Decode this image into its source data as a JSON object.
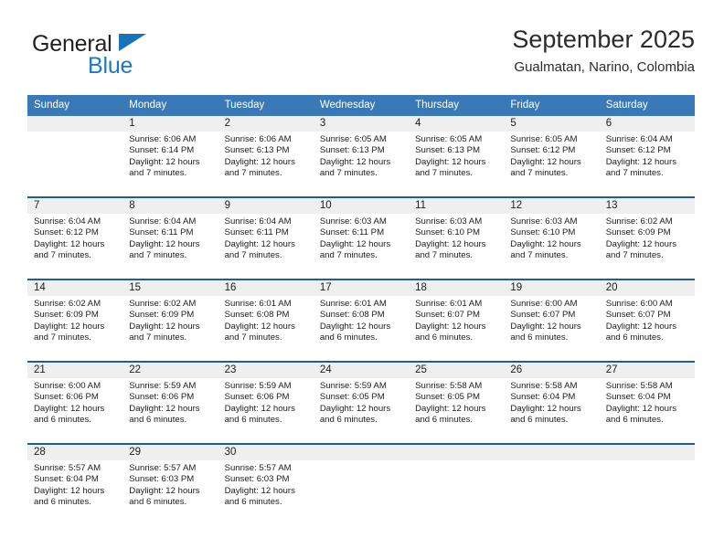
{
  "logo": {
    "word1": "General",
    "word2": "Blue",
    "triangle_color": "#1573ba",
    "word2_color": "#1b7ac0"
  },
  "header": {
    "title": "September 2025",
    "subtitle": "Gualmatan, Narino, Colombia"
  },
  "theme": {
    "header_blue": "#3a79b8",
    "row_divider_blue": "#1a5e9e",
    "day_band_gray": "#efefef"
  },
  "weekdays": [
    "Sunday",
    "Monday",
    "Tuesday",
    "Wednesday",
    "Thursday",
    "Friday",
    "Saturday"
  ],
  "weeks": [
    [
      {
        "day": "",
        "empty": true
      },
      {
        "day": "1",
        "sunrise": "Sunrise: 6:06 AM",
        "sunset": "Sunset: 6:14 PM",
        "daylight_l1": "Daylight: 12 hours",
        "daylight_l2": "and 7 minutes."
      },
      {
        "day": "2",
        "sunrise": "Sunrise: 6:06 AM",
        "sunset": "Sunset: 6:13 PM",
        "daylight_l1": "Daylight: 12 hours",
        "daylight_l2": "and 7 minutes."
      },
      {
        "day": "3",
        "sunrise": "Sunrise: 6:05 AM",
        "sunset": "Sunset: 6:13 PM",
        "daylight_l1": "Daylight: 12 hours",
        "daylight_l2": "and 7 minutes."
      },
      {
        "day": "4",
        "sunrise": "Sunrise: 6:05 AM",
        "sunset": "Sunset: 6:13 PM",
        "daylight_l1": "Daylight: 12 hours",
        "daylight_l2": "and 7 minutes."
      },
      {
        "day": "5",
        "sunrise": "Sunrise: 6:05 AM",
        "sunset": "Sunset: 6:12 PM",
        "daylight_l1": "Daylight: 12 hours",
        "daylight_l2": "and 7 minutes."
      },
      {
        "day": "6",
        "sunrise": "Sunrise: 6:04 AM",
        "sunset": "Sunset: 6:12 PM",
        "daylight_l1": "Daylight: 12 hours",
        "daylight_l2": "and 7 minutes."
      }
    ],
    [
      {
        "day": "7",
        "sunrise": "Sunrise: 6:04 AM",
        "sunset": "Sunset: 6:12 PM",
        "daylight_l1": "Daylight: 12 hours",
        "daylight_l2": "and 7 minutes."
      },
      {
        "day": "8",
        "sunrise": "Sunrise: 6:04 AM",
        "sunset": "Sunset: 6:11 PM",
        "daylight_l1": "Daylight: 12 hours",
        "daylight_l2": "and 7 minutes."
      },
      {
        "day": "9",
        "sunrise": "Sunrise: 6:04 AM",
        "sunset": "Sunset: 6:11 PM",
        "daylight_l1": "Daylight: 12 hours",
        "daylight_l2": "and 7 minutes."
      },
      {
        "day": "10",
        "sunrise": "Sunrise: 6:03 AM",
        "sunset": "Sunset: 6:11 PM",
        "daylight_l1": "Daylight: 12 hours",
        "daylight_l2": "and 7 minutes."
      },
      {
        "day": "11",
        "sunrise": "Sunrise: 6:03 AM",
        "sunset": "Sunset: 6:10 PM",
        "daylight_l1": "Daylight: 12 hours",
        "daylight_l2": "and 7 minutes."
      },
      {
        "day": "12",
        "sunrise": "Sunrise: 6:03 AM",
        "sunset": "Sunset: 6:10 PM",
        "daylight_l1": "Daylight: 12 hours",
        "daylight_l2": "and 7 minutes."
      },
      {
        "day": "13",
        "sunrise": "Sunrise: 6:02 AM",
        "sunset": "Sunset: 6:09 PM",
        "daylight_l1": "Daylight: 12 hours",
        "daylight_l2": "and 7 minutes."
      }
    ],
    [
      {
        "day": "14",
        "sunrise": "Sunrise: 6:02 AM",
        "sunset": "Sunset: 6:09 PM",
        "daylight_l1": "Daylight: 12 hours",
        "daylight_l2": "and 7 minutes."
      },
      {
        "day": "15",
        "sunrise": "Sunrise: 6:02 AM",
        "sunset": "Sunset: 6:09 PM",
        "daylight_l1": "Daylight: 12 hours",
        "daylight_l2": "and 7 minutes."
      },
      {
        "day": "16",
        "sunrise": "Sunrise: 6:01 AM",
        "sunset": "Sunset: 6:08 PM",
        "daylight_l1": "Daylight: 12 hours",
        "daylight_l2": "and 7 minutes."
      },
      {
        "day": "17",
        "sunrise": "Sunrise: 6:01 AM",
        "sunset": "Sunset: 6:08 PM",
        "daylight_l1": "Daylight: 12 hours",
        "daylight_l2": "and 6 minutes."
      },
      {
        "day": "18",
        "sunrise": "Sunrise: 6:01 AM",
        "sunset": "Sunset: 6:07 PM",
        "daylight_l1": "Daylight: 12 hours",
        "daylight_l2": "and 6 minutes."
      },
      {
        "day": "19",
        "sunrise": "Sunrise: 6:00 AM",
        "sunset": "Sunset: 6:07 PM",
        "daylight_l1": "Daylight: 12 hours",
        "daylight_l2": "and 6 minutes."
      },
      {
        "day": "20",
        "sunrise": "Sunrise: 6:00 AM",
        "sunset": "Sunset: 6:07 PM",
        "daylight_l1": "Daylight: 12 hours",
        "daylight_l2": "and 6 minutes."
      }
    ],
    [
      {
        "day": "21",
        "sunrise": "Sunrise: 6:00 AM",
        "sunset": "Sunset: 6:06 PM",
        "daylight_l1": "Daylight: 12 hours",
        "daylight_l2": "and 6 minutes."
      },
      {
        "day": "22",
        "sunrise": "Sunrise: 5:59 AM",
        "sunset": "Sunset: 6:06 PM",
        "daylight_l1": "Daylight: 12 hours",
        "daylight_l2": "and 6 minutes."
      },
      {
        "day": "23",
        "sunrise": "Sunrise: 5:59 AM",
        "sunset": "Sunset: 6:06 PM",
        "daylight_l1": "Daylight: 12 hours",
        "daylight_l2": "and 6 minutes."
      },
      {
        "day": "24",
        "sunrise": "Sunrise: 5:59 AM",
        "sunset": "Sunset: 6:05 PM",
        "daylight_l1": "Daylight: 12 hours",
        "daylight_l2": "and 6 minutes."
      },
      {
        "day": "25",
        "sunrise": "Sunrise: 5:58 AM",
        "sunset": "Sunset: 6:05 PM",
        "daylight_l1": "Daylight: 12 hours",
        "daylight_l2": "and 6 minutes."
      },
      {
        "day": "26",
        "sunrise": "Sunrise: 5:58 AM",
        "sunset": "Sunset: 6:04 PM",
        "daylight_l1": "Daylight: 12 hours",
        "daylight_l2": "and 6 minutes."
      },
      {
        "day": "27",
        "sunrise": "Sunrise: 5:58 AM",
        "sunset": "Sunset: 6:04 PM",
        "daylight_l1": "Daylight: 12 hours",
        "daylight_l2": "and 6 minutes."
      }
    ],
    [
      {
        "day": "28",
        "sunrise": "Sunrise: 5:57 AM",
        "sunset": "Sunset: 6:04 PM",
        "daylight_l1": "Daylight: 12 hours",
        "daylight_l2": "and 6 minutes."
      },
      {
        "day": "29",
        "sunrise": "Sunrise: 5:57 AM",
        "sunset": "Sunset: 6:03 PM",
        "daylight_l1": "Daylight: 12 hours",
        "daylight_l2": "and 6 minutes."
      },
      {
        "day": "30",
        "sunrise": "Sunrise: 5:57 AM",
        "sunset": "Sunset: 6:03 PM",
        "daylight_l1": "Daylight: 12 hours",
        "daylight_l2": "and 6 minutes."
      },
      {
        "day": "",
        "empty": true
      },
      {
        "day": "",
        "empty": true
      },
      {
        "day": "",
        "empty": true
      },
      {
        "day": "",
        "empty": true
      }
    ]
  ]
}
